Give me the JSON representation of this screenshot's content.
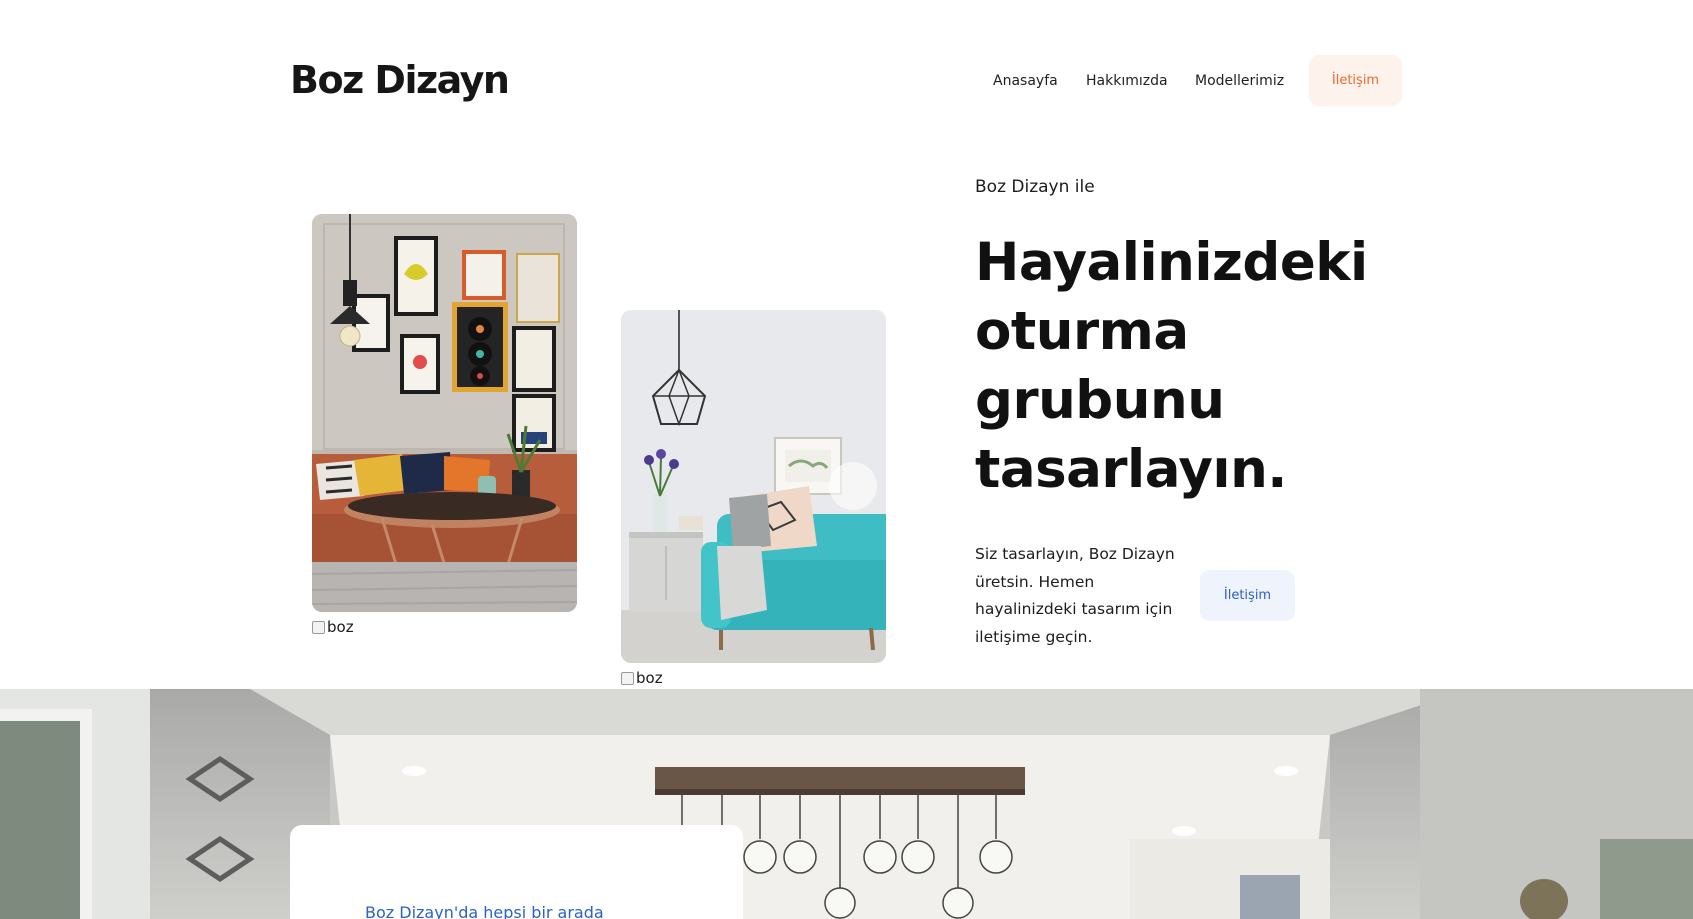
{
  "header": {
    "logo": "Boz Dizayn",
    "nav": [
      {
        "label": "Anasayfa"
      },
      {
        "label": "Hakkımızda"
      },
      {
        "label": "Modellerimiz"
      }
    ],
    "cta_label": "İletişim"
  },
  "hero": {
    "eyebrow": "Boz Dizayn ile",
    "headline": "Hayalinizdeki oturma grubunu tasarlayın.",
    "lead": "Siz tasarlayın, Boz Dizayn üretsin. Hemen hayalinizdeki tasarım için iletişime geçin.",
    "cta_label": "İletişim",
    "images": [
      {
        "alt": "boz"
      },
      {
        "alt": "boz"
      }
    ]
  },
  "feature": {
    "tagline": "Boz Dizayn'da hepsi bir arada"
  },
  "colors": {
    "nav_cta_bg": "#fdf2ec",
    "nav_cta_text": "#ec6a2e",
    "hero_cta_bg": "#eef3fc",
    "hero_cta_text": "#2e5fc2",
    "tagline_text": "#2a62c9"
  }
}
